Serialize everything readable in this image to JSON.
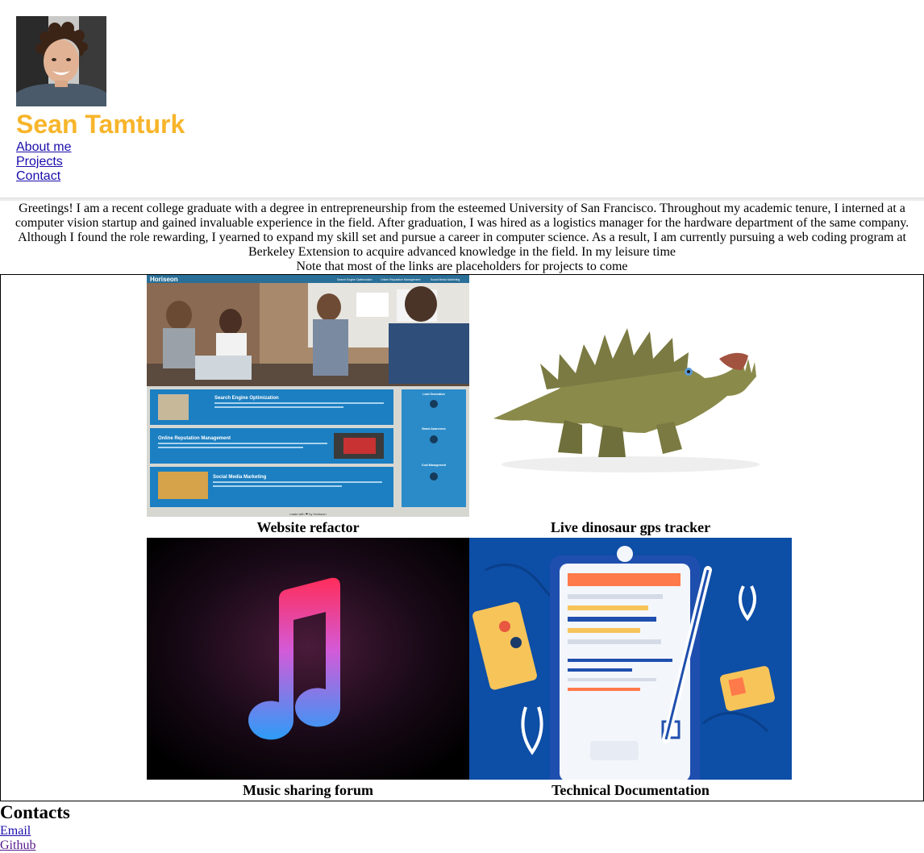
{
  "profile": {
    "name": "Sean Tamturk",
    "avatar_icon": "person-avatar-photo"
  },
  "nav": {
    "items": [
      "About me",
      "Projects",
      "Contact"
    ]
  },
  "about": {
    "paragraph": "Greetings! I am a recent college graduate with a degree in entrepreneurship from the esteemed University of San Francisco. Throughout my academic tenure, I interned at a computer vision startup and gained invaluable experience in the field. After graduation, I was hired as a logistics manager for the hardware department of the same company. Although I found the role rewarding, I yearned to expand my skill set and pursue a career in computer science. As a result, I am currently pursuing a web coding program at Berkeley Extension to acquire advanced knowledge in the field. In my leisure time",
    "note": "Note that most of the links are placeholders for projects to come"
  },
  "projects": [
    {
      "caption": "Website refactor",
      "image_icon": "website-screenshot",
      "screenshot": {
        "brand": "Horiseon",
        "nav": [
          "Search Engine Optimization",
          "Online Reputation Management",
          "Social Media Marketing"
        ],
        "sections": [
          "Search Engine Optimization",
          "Online Reputation Management",
          "Social Media Marketing"
        ],
        "side": [
          "Lead Generation",
          "Brand Awareness",
          "Cost Management"
        ],
        "footer": "made with ❤ by Horiseon"
      }
    },
    {
      "caption": "Live dinosaur gps tracker",
      "image_icon": "dinosaur-toy-photo"
    },
    {
      "caption": "Music sharing forum",
      "image_icon": "music-note-icon"
    },
    {
      "caption": "Technical Documentation",
      "image_icon": "documentation-illustration"
    }
  ],
  "contacts": {
    "heading": "Contacts",
    "links": [
      "Email",
      "Github"
    ]
  },
  "colors": {
    "name": "#f7b52b",
    "link": "#1a0dab",
    "visited_link": "#551a8b",
    "horiseon_blue": "#1b7fc1",
    "doc_blue": "#0d4ea6"
  }
}
